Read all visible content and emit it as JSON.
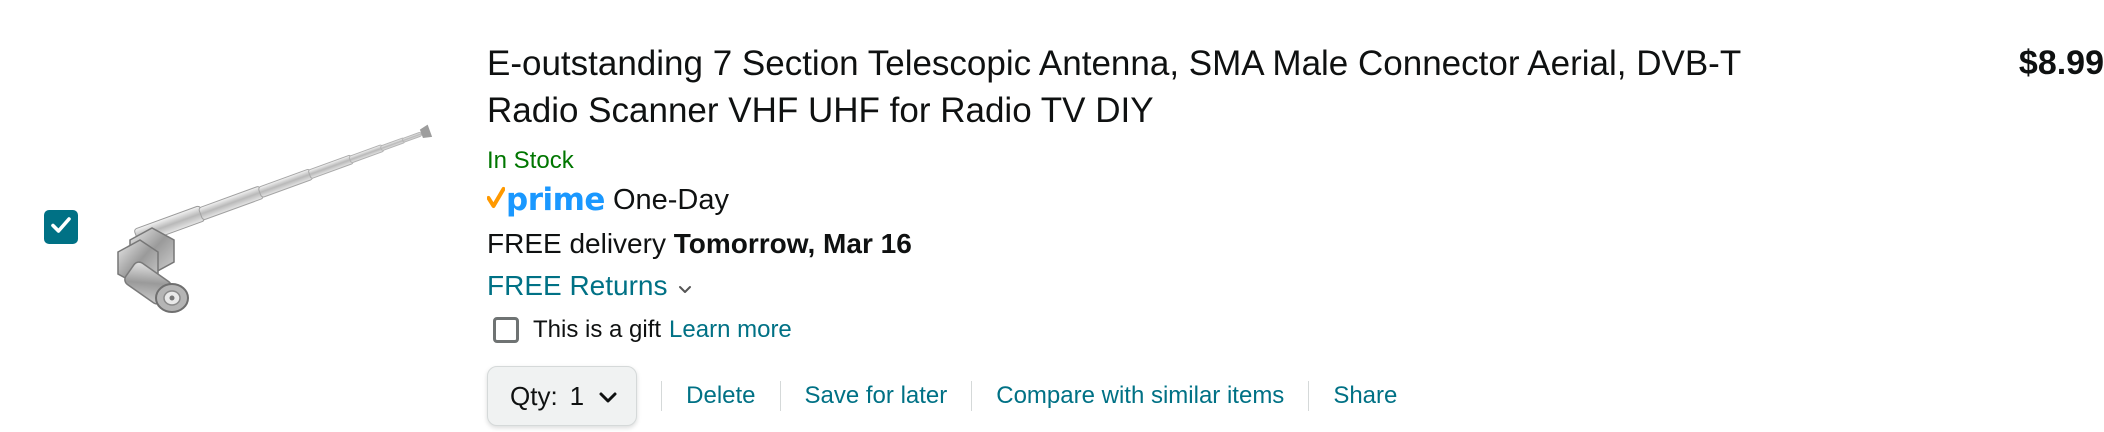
{
  "cart_item": {
    "selected": true,
    "title": "E-outstanding 7 Section Telescopic Antenna, SMA Male Connector Aerial, DVB-T Radio Scanner VHF UHF for Radio TV DIY",
    "stock": "In Stock",
    "prime": {
      "logo_text": "prime",
      "speed": "One-Day"
    },
    "delivery": {
      "prefix": "FREE delivery",
      "date": "Tomorrow, Mar 16"
    },
    "returns": "FREE Returns",
    "gift": {
      "label": "This is a gift",
      "link": "Learn more"
    },
    "quantity": {
      "label": "Qty:",
      "value": "1"
    },
    "actions": {
      "delete": "Delete",
      "save_for_later": "Save for later",
      "compare": "Compare with similar items",
      "share": "Share"
    },
    "price": "$8.99"
  },
  "colors": {
    "link": "#007185",
    "in_stock": "#007600",
    "prime_blue": "#1a98ff",
    "prime_check": "#ff9900",
    "checkbox_fill": "#007185"
  }
}
